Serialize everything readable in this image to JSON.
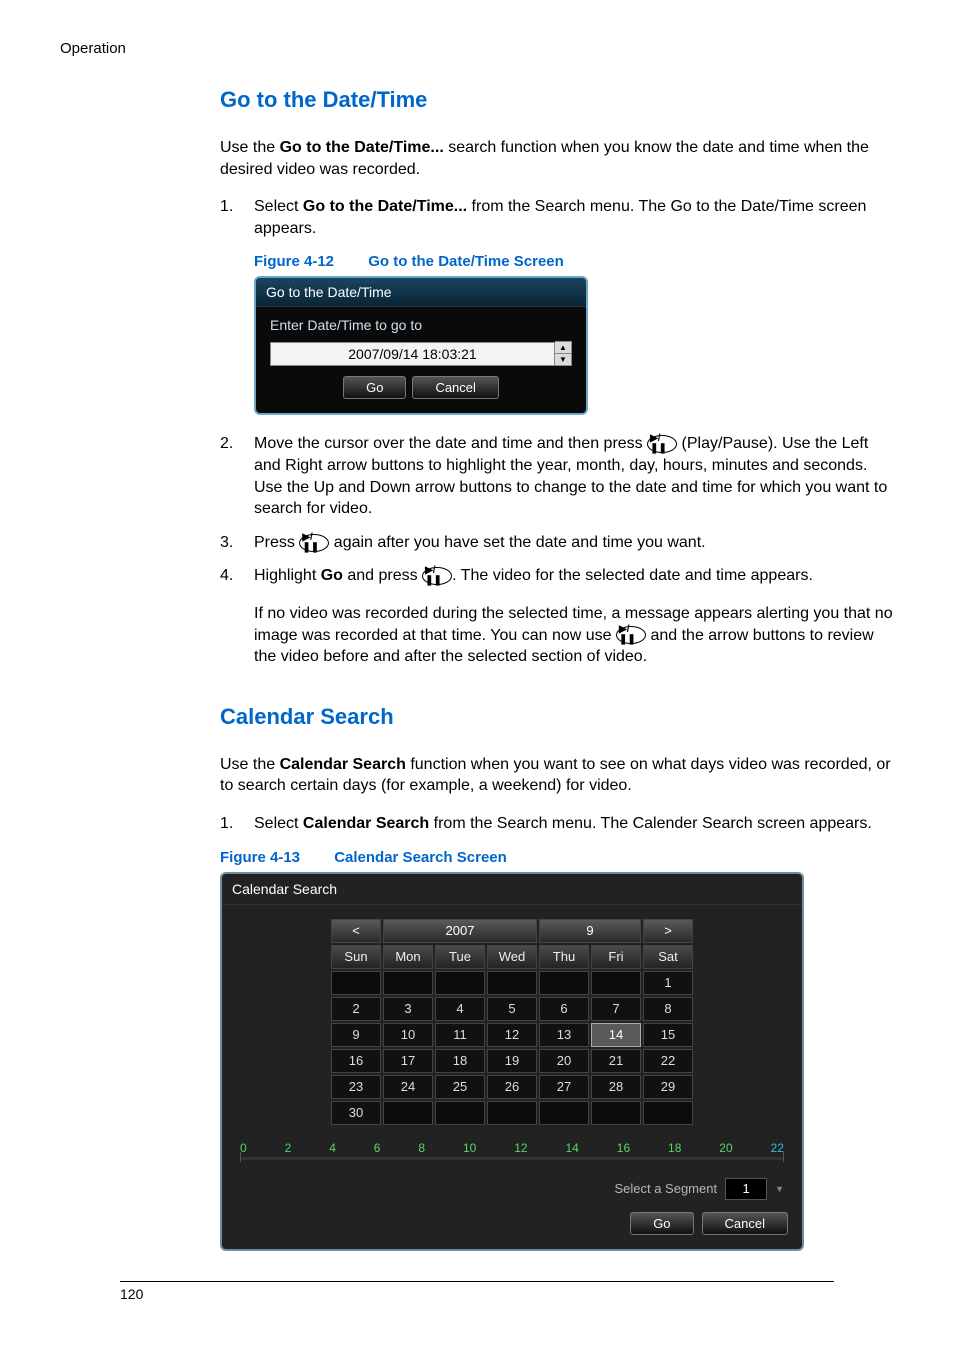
{
  "running_header": "Operation",
  "section_goto_title": "Go to the Date/Time",
  "intro_goto_a": "Use the ",
  "intro_goto_bold": "Go to the Date/Time...",
  "intro_goto_b": " search function when you know the date and time when the desired video was recorded.",
  "step_goto_1_a": "Select ",
  "step_goto_1_bold": "Go to the Date/Time...",
  "step_goto_1_b": " from the Search menu. The Go to the Date/Time screen appears.",
  "figure12_num": "Figure 4-12",
  "figure12_title": "Go to the Date/Time Screen",
  "dlg_goto": {
    "title": "Go to the Date/Time",
    "label": "Enter Date/Time to go to",
    "value": "2007/09/14  18:03:21",
    "btn_go": "Go",
    "btn_cancel": "Cancel"
  },
  "step_goto_2": "Move the cursor over the date and time and then press        (Play/Pause). Use the Left and Right arrow buttons to highlight the year, month, day, hours, minutes and seconds. Use the Up and Down arrow buttons to change to the date and time for which you want to search for video.",
  "pp_icon_label": "▶/❚❚",
  "step_goto_3_a": "Press ",
  "step_goto_3_b": " again after you have set the date and time you want.",
  "step_goto_4_a": "Highlight ",
  "step_goto_4_bold": "Go",
  "step_goto_4_b": " and press ",
  "step_goto_4_c": ". The video for the selected date and time appears.",
  "step_goto_4_para_a": "If no video was recorded during the selected time, a message appears alerting you that no image was recorded at that time. You can now use ",
  "step_goto_4_para_b": " and the arrow buttons to review the video before and after the selected section of video.",
  "section_cal_title": "Calendar Search",
  "intro_cal_a": "Use the ",
  "intro_cal_bold": "Calendar Search",
  "intro_cal_b": " function when you want to see on what days video was recorded, or to search certain days (for example, a weekend) for video.",
  "step_cal_1_a": "Select ",
  "step_cal_1_bold": "Calendar Search",
  "step_cal_1_b": " from the Search menu. The Calender Search screen appears.",
  "figure13_num": "Figure 4-13",
  "figure13_title": "Calendar Search Screen",
  "cal_screen": {
    "title": "Calendar Search",
    "prev": "<",
    "year": "2007",
    "month": "9",
    "next": ">",
    "dow": [
      "Sun",
      "Mon",
      "Tue",
      "Wed",
      "Thu",
      "Fri",
      "Sat"
    ],
    "weeks": [
      [
        "",
        "",
        "",
        "",
        "",
        "",
        "1"
      ],
      [
        "2",
        "3",
        "4",
        "5",
        "6",
        "7",
        "8"
      ],
      [
        "9",
        "10",
        "11",
        "12",
        "13",
        "14",
        "15"
      ],
      [
        "16",
        "17",
        "18",
        "19",
        "20",
        "21",
        "22"
      ],
      [
        "23",
        "24",
        "25",
        "26",
        "27",
        "28",
        "29"
      ],
      [
        "30",
        "",
        "",
        "",
        "",
        "",
        ""
      ]
    ],
    "selected": "14",
    "timeline": [
      "0",
      "2",
      "4",
      "6",
      "8",
      "10",
      "12",
      "14",
      "16",
      "18",
      "20",
      "22"
    ],
    "select_segment_label": "Select a Segment",
    "segment_value": "1",
    "btn_go": "Go",
    "btn_cancel": "Cancel"
  },
  "page_number": "120"
}
